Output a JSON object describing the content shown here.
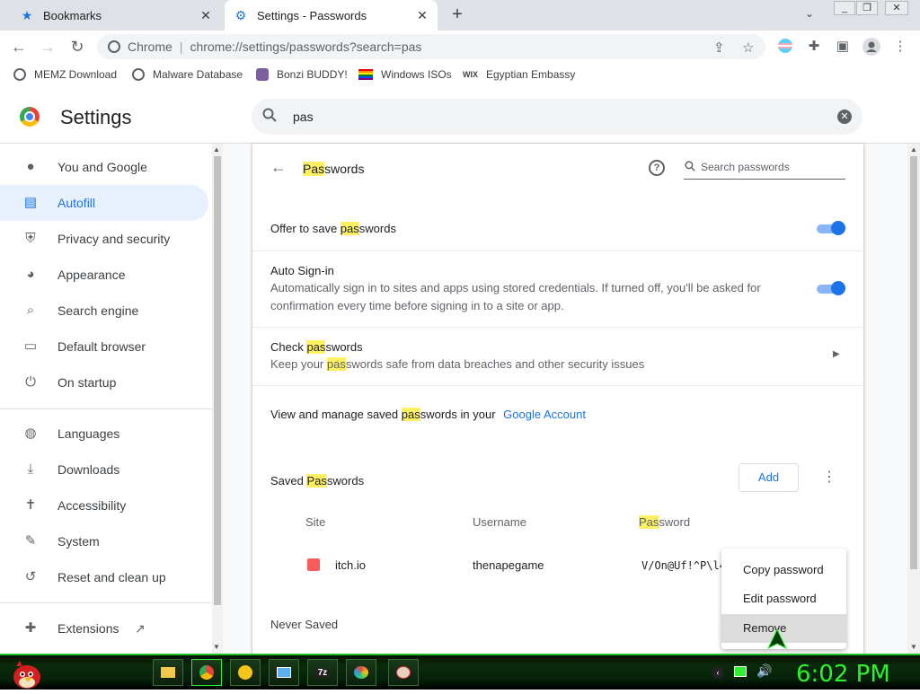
{
  "tabs": [
    {
      "title": "Bookmarks",
      "icon": "star-icon"
    },
    {
      "title": "Settings - Passwords",
      "icon": "gear-icon"
    }
  ],
  "window_controls": {
    "minimize": "_",
    "restore": "❐",
    "close": "✕"
  },
  "omnibox": {
    "site_label": "Chrome",
    "separator": "|",
    "url": "chrome://settings/passwords?search=pas"
  },
  "bookmarks": [
    {
      "label": "MEMZ Download"
    },
    {
      "label": "Malware Database"
    },
    {
      "label": "Bonzi BUDDY!"
    },
    {
      "label": "Windows ISOs"
    },
    {
      "label": "Egyptian Embassy",
      "prefix": "WIX"
    }
  ],
  "settings": {
    "title": "Settings",
    "search_value": "pas"
  },
  "sidebar": {
    "items": [
      {
        "label": "You and Google",
        "icon": "person-icon"
      },
      {
        "label": "Autofill",
        "icon": "clipboard-icon"
      },
      {
        "label": "Privacy and security",
        "icon": "shield-icon"
      },
      {
        "label": "Appearance",
        "icon": "palette-icon"
      },
      {
        "label": "Search engine",
        "icon": "search-icon"
      },
      {
        "label": "Default browser",
        "icon": "browser-icon"
      },
      {
        "label": "On startup",
        "icon": "power-icon"
      },
      {
        "label": "Languages",
        "icon": "globe-icon"
      },
      {
        "label": "Downloads",
        "icon": "download-icon"
      },
      {
        "label": "Accessibility",
        "icon": "accessibility-icon"
      },
      {
        "label": "System",
        "icon": "wrench-icon"
      },
      {
        "label": "Reset and clean up",
        "icon": "history-icon"
      },
      {
        "label": "Extensions",
        "icon": "puzzle-icon"
      }
    ],
    "active_index": 1
  },
  "passwords": {
    "title_hl": "Pas",
    "title_rest": "swords",
    "search_placeholder": "Search passwords",
    "offer_pre": "Offer to save ",
    "offer_hl": "pas",
    "offer_post": "swords",
    "offer_enabled": true,
    "auto_signin_title": "Auto Sign-in",
    "auto_signin_desc": "Automatically sign in to sites and apps using stored credentials. If turned off, you'll be asked for confirmation every time before signing in to a site or app.",
    "auto_signin_enabled": true,
    "check_pre": "Check ",
    "check_hl": "pas",
    "check_post": "swords",
    "check_desc_pre": "Keep your ",
    "check_desc_hl": "pas",
    "check_desc_post": "swords safe from data breaches and other security issues",
    "manage_pre": "View and manage saved ",
    "manage_hl": "pas",
    "manage_post": "swords in your",
    "manage_link": "Google Account",
    "saved_pre": "Saved ",
    "saved_hl": "Pas",
    "saved_post": "swords",
    "add_label": "Add",
    "columns": {
      "site": "Site",
      "username": "Username",
      "password_hl": "Pas",
      "password_rest": "sword"
    },
    "entries": [
      {
        "site": "itch.io",
        "username": "thenapegame",
        "password": "V/On@Uf!^P\\l4"
      }
    ],
    "never_saved": "Never Saved"
  },
  "context_menu": {
    "items": [
      "Copy password",
      "Edit password",
      "Remove"
    ],
    "hover_index": 2
  },
  "taskbar": {
    "clock": "6:02 PM"
  }
}
